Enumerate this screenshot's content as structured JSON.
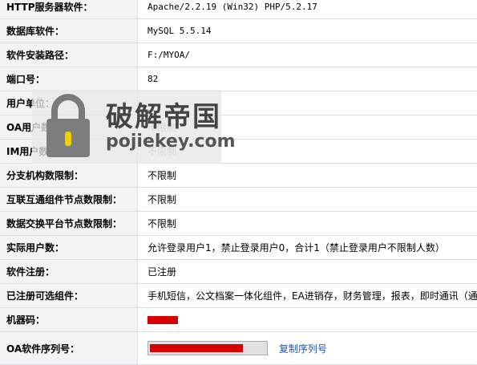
{
  "rows": [
    {
      "label": "HTTP服务器软件",
      "value": "Apache/2.2.19 (Win32) PHP/5.2.17"
    },
    {
      "label": "数据库软件",
      "value": "MySQL 5.5.14"
    },
    {
      "label": "软件安装路径",
      "value": "F:/MYOA/"
    },
    {
      "label": "端口号",
      "value": "82"
    },
    {
      "label": "用户单位",
      "value": ""
    },
    {
      "label": "OA用户数限制",
      "value": "不限制"
    },
    {
      "label": "IM用户数限制",
      "value": "不限制"
    },
    {
      "label": "分支机构数限制",
      "value": "不限制"
    },
    {
      "label": "互联互通组件节点数限制",
      "value": "不限制"
    },
    {
      "label": "数据交换平台节点数限制",
      "value": "不限制"
    },
    {
      "label": "实际用户数",
      "value": "允许登录用户1，禁止登录用户0，合计1（禁止登录用户不限制人数）"
    },
    {
      "label": "软件注册",
      "value": "已注册"
    },
    {
      "label": "已注册可选组件",
      "value": "手机短信，公文档案一体化组件，EA进销存，财务管理，报表，即时通讯（通讯录）"
    },
    {
      "label": "机器码",
      "value": ""
    },
    {
      "label": "OA软件序列号",
      "value": ""
    }
  ],
  "copy_serial_label": "复制序列号",
  "watermark": {
    "title": "破解帝国",
    "site": "pojiekey.com",
    "icon": "lock-icon"
  },
  "colors": {
    "redaction": "#d90000",
    "link": "#1f55b8",
    "label_bg": "#f3f3f3"
  }
}
